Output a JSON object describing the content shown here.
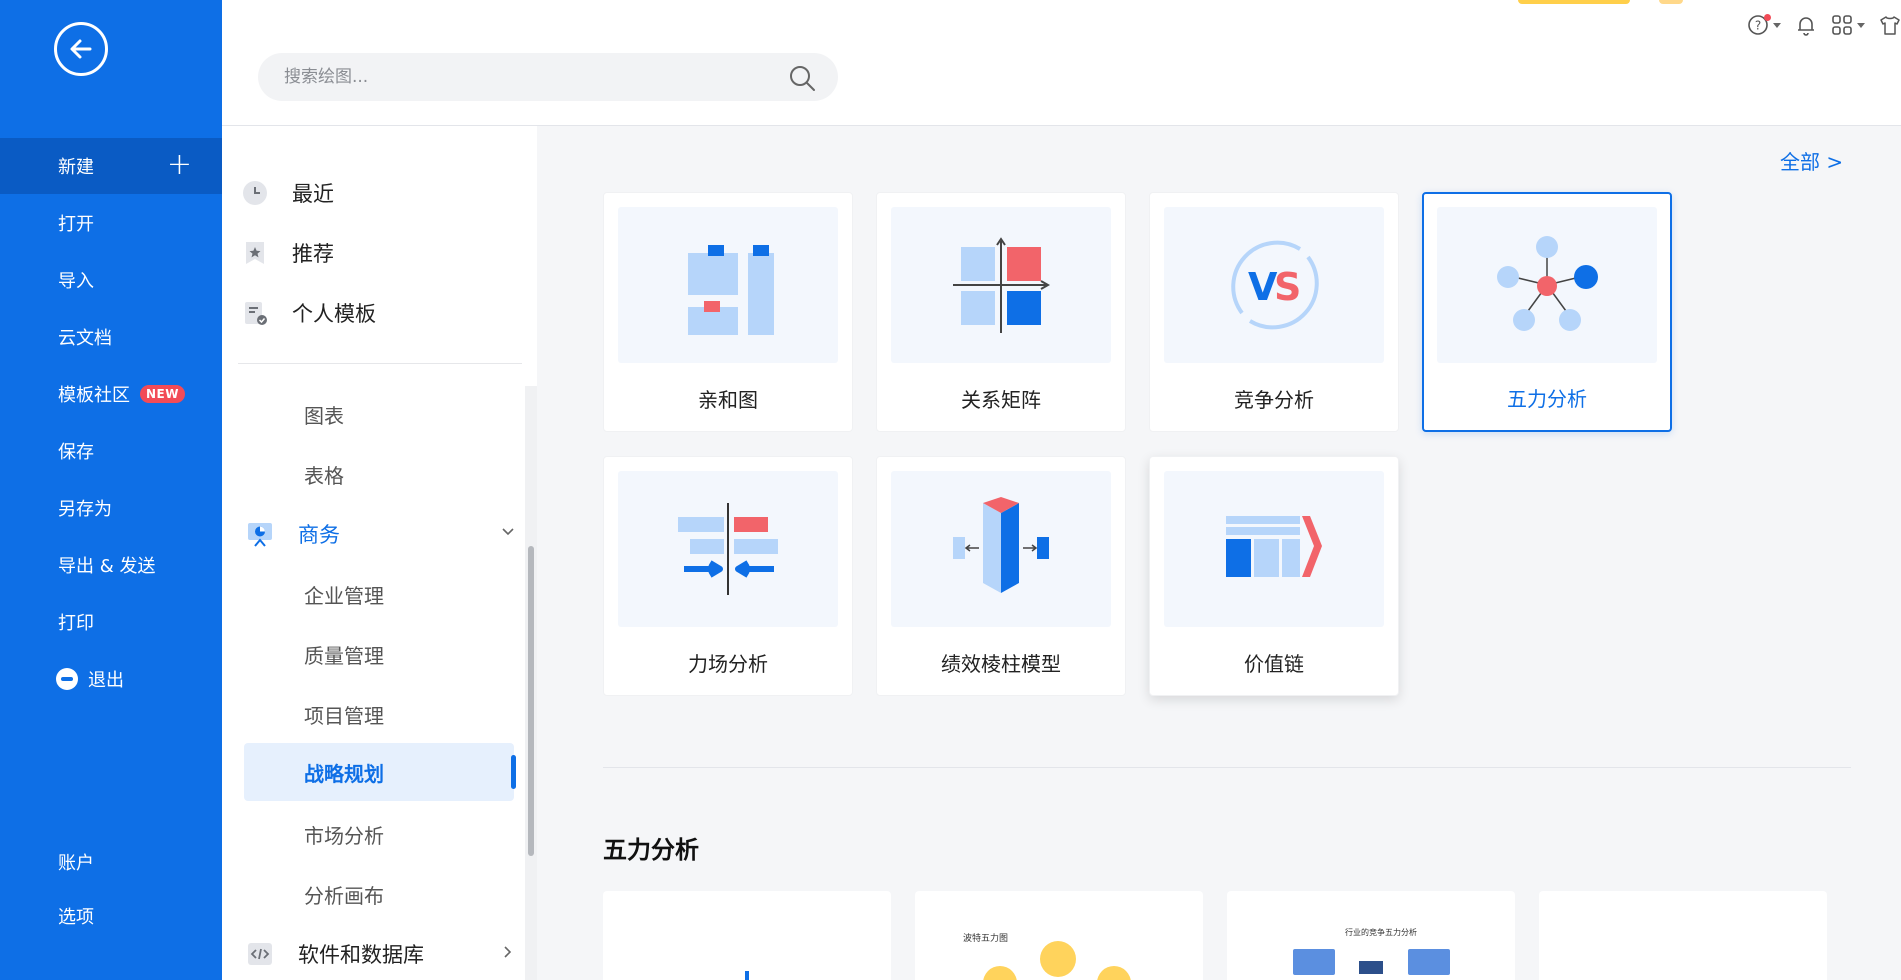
{
  "sidebar": {
    "new_label": "新建",
    "open_label": "打开",
    "import_label": "导入",
    "cloud_label": "云文档",
    "community_label": "模板社区",
    "community_badge": "NEW",
    "save_label": "保存",
    "save_as_label": "另存为",
    "export_label": "导出 & 发送",
    "print_label": "打印",
    "exit_label": "退出",
    "account_label": "账户",
    "options_label": "选项"
  },
  "search": {
    "placeholder": "搜索绘图..."
  },
  "categories": {
    "recent": "最近",
    "recommended": "推荐",
    "personal": "个人模板",
    "chart": "图表",
    "table": "表格",
    "business": "商务",
    "business_items": [
      "企业管理",
      "质量管理",
      "项目管理",
      "战略规划",
      "市场分析",
      "分析画布"
    ],
    "software": "软件和数据库"
  },
  "main": {
    "view_all": "全部  >",
    "cards": [
      "亲和图",
      "关系矩阵",
      "竞争分析",
      "五力分析",
      "力场分析",
      "绩效棱柱模型",
      "价值链"
    ],
    "section_title": "五力分析",
    "preview_texts": [
      "波特五力图",
      "行业的竞争五力分析"
    ]
  },
  "colors": {
    "brand": "#0e6fe6",
    "badge": "#f24b57",
    "accent_red": "#f2646a",
    "light_blue": "#b6d5fa"
  }
}
